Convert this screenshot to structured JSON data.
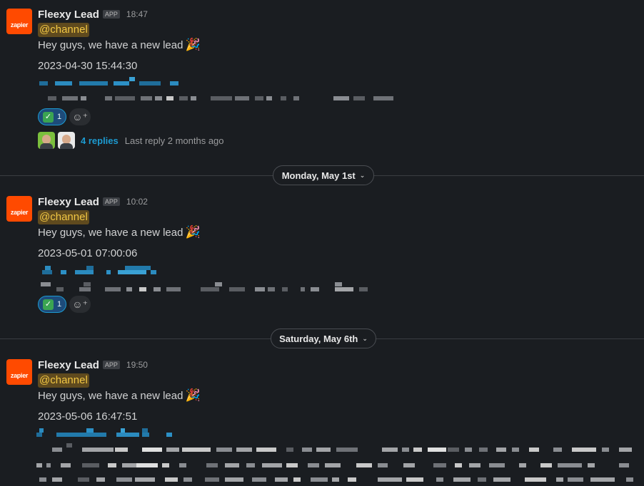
{
  "messages": [
    {
      "sender": "Fleexy Lead",
      "badge": "APP",
      "time": "18:47",
      "avatar_text": "zapier",
      "mention": "@channel",
      "text": "Hey guys, we have a new lead",
      "emoji": "🎉",
      "date_value": "2023-04-30 15:44:30",
      "reaction": {
        "emoji": "✓",
        "count": "1"
      },
      "thread": {
        "replies": "4 replies",
        "last": "Last reply 2 months ago"
      }
    },
    {
      "sender": "Fleexy Lead",
      "badge": "APP",
      "time": "10:02",
      "avatar_text": "zapier",
      "mention": "@channel",
      "text": "Hey guys, we have a new lead",
      "emoji": "🎉",
      "date_value": "2023-05-01 07:00:06",
      "reaction": {
        "emoji": "✓",
        "count": "1"
      }
    },
    {
      "sender": "Fleexy Lead",
      "badge": "APP",
      "time": "19:50",
      "avatar_text": "zapier",
      "mention": "@channel",
      "text": "Hey guys, we have a new lead",
      "emoji": "🎉",
      "date_value": "2023-05-06 16:47:51"
    }
  ],
  "dividers": [
    "Monday, May 1st",
    "Saturday, May 6th"
  ],
  "colors": {
    "brand_avatar": "#ff4a00",
    "link": "#1d9bd1",
    "mention_bg": "#5f4a1e",
    "mention_text": "#f2c744"
  },
  "icons": {
    "add_reaction": "add-reaction-icon",
    "chevron": "chevron-down-icon"
  }
}
